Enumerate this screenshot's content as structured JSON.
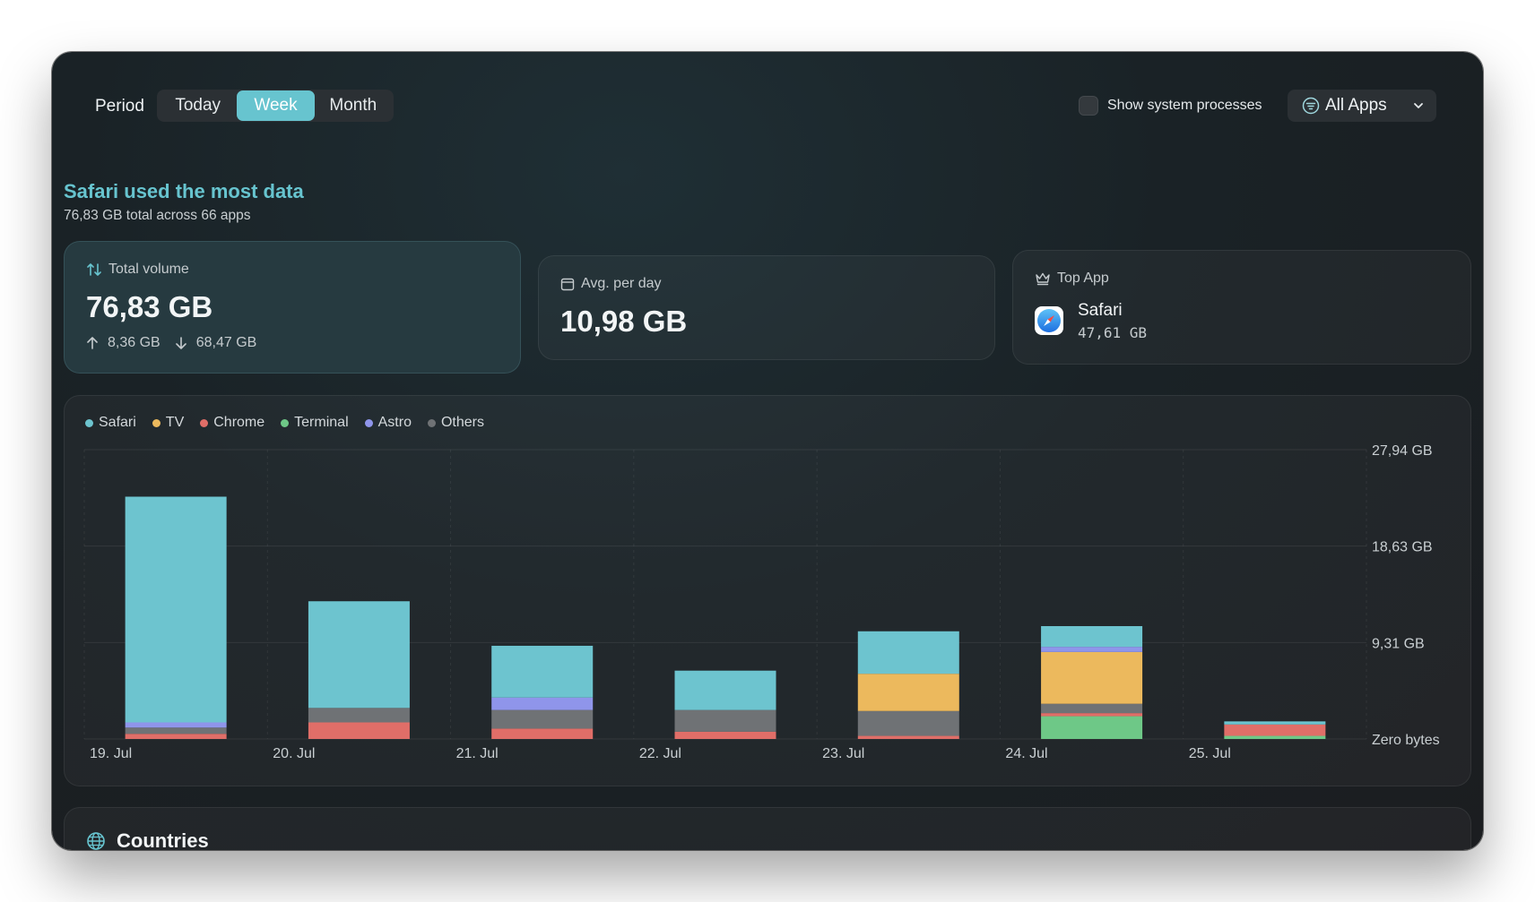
{
  "toolbar": {
    "period_label": "Period",
    "tabs": [
      "Today",
      "Week",
      "Month"
    ],
    "selected_tab": "Week",
    "system_processes_label": "Show system processes",
    "system_processes_checked": false,
    "apps_filter": "All Apps"
  },
  "summary": {
    "headline": "Safari used the most data",
    "subline": "76,83 GB total across 66 apps"
  },
  "cards": {
    "total": {
      "label": "Total volume",
      "value": "76,83 GB",
      "up": "8,36 GB",
      "down": "68,47 GB"
    },
    "avg": {
      "label": "Avg. per day",
      "value": "10,98 GB"
    },
    "top": {
      "label": "Top App",
      "app": "Safari",
      "value": "47,61 GB"
    }
  },
  "colors": {
    "Safari": "#6dc4cf",
    "TV": "#ecb95d",
    "Chrome": "#e06e68",
    "Terminal": "#6ec887",
    "Astro": "#8f95ea",
    "Others": "#6f7275",
    "accent": "#67c4cf"
  },
  "chart_data": {
    "type": "bar",
    "stacked": true,
    "categories": [
      "19. Jul",
      "20. Jul",
      "21. Jul",
      "22. Jul",
      "23. Jul",
      "24. Jul",
      "25. Jul"
    ],
    "y_ticks": [
      "Zero bytes",
      "9,31 GB",
      "18,63 GB",
      "27,94 GB"
    ],
    "ylim": [
      0,
      27.94
    ],
    "legend": [
      "Safari",
      "TV",
      "Chrome",
      "Terminal",
      "Astro",
      "Others"
    ],
    "legend_position": "top-left",
    "y_axis_side": "right",
    "stack_order": [
      "Terminal",
      "Chrome",
      "Others",
      "TV",
      "Astro",
      "Safari"
    ],
    "series": [
      {
        "name": "Safari",
        "values": [
          21.8,
          10.3,
          5.0,
          3.8,
          4.1,
          2.0,
          0.3
        ]
      },
      {
        "name": "TV",
        "values": [
          0,
          0,
          0,
          0,
          3.6,
          5.0,
          0
        ]
      },
      {
        "name": "Chrome",
        "values": [
          0.5,
          1.6,
          1.0,
          0.7,
          0.3,
          0.3,
          1.1
        ]
      },
      {
        "name": "Terminal",
        "values": [
          0,
          0,
          0,
          0,
          0,
          2.2,
          0.3
        ]
      },
      {
        "name": "Astro",
        "values": [
          0.5,
          0,
          1.2,
          0,
          0,
          0.5,
          0
        ]
      },
      {
        "name": "Others",
        "values": [
          0.6,
          1.4,
          1.8,
          2.1,
          2.4,
          0.9,
          0
        ]
      }
    ]
  },
  "countries": {
    "title": "Countries"
  }
}
